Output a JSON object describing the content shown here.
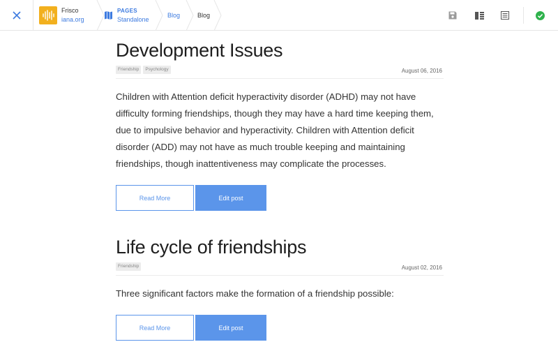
{
  "site": {
    "name": "Frisco",
    "domain": "iana.org"
  },
  "breadcrumb": {
    "section_title": "PAGES",
    "section_sub": "Standalone",
    "items": [
      "Blog",
      "Blog"
    ]
  },
  "colors": {
    "accent": "#5b95ea",
    "logo": "#f2b01e",
    "ok": "#2fb24c"
  },
  "icons": [
    "close-icon",
    "equalizer-logo-icon",
    "map-icon",
    "save-icon",
    "columns-icon",
    "list-icon",
    "check-circle-icon"
  ],
  "posts": [
    {
      "title": "Development Issues",
      "tags": [
        "Friendship",
        "Psychology"
      ],
      "date": "August 06, 2016",
      "excerpt": "Children with Attention deficit hyperactivity disorder (ADHD) may not have difficulty forming friendships, though they may have a hard time keeping them, due to impulsive behavior and hyperactivity. Children with Attention deficit disorder (ADD) may not have as much trouble keeping and maintaining friendships, though inattentiveness may complicate the processes.",
      "read_more": "Read More",
      "edit": "Edit post"
    },
    {
      "title": "Life cycle of friendships",
      "tags": [
        "Friendship"
      ],
      "date": "August 02, 2016",
      "excerpt": "Three significant factors make the formation of a friendship possible:",
      "read_more": "Read More",
      "edit": "Edit post"
    }
  ]
}
